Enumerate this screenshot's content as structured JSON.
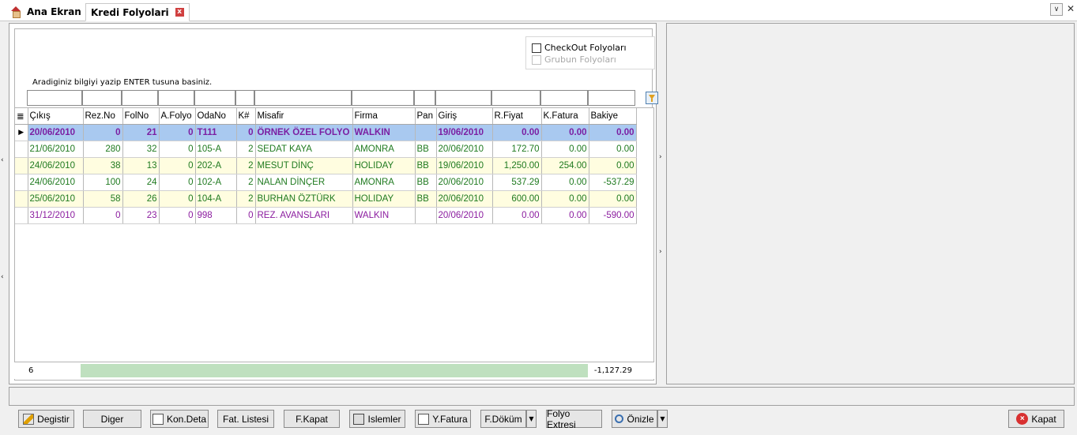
{
  "tabs": {
    "home": "Ana Ekran",
    "active": "Kredi Folyolari",
    "close_glyph": "x"
  },
  "window": {
    "dropdown_glyph": "∨",
    "close_glyph": "✕"
  },
  "filter": {
    "checkout_label": "CheckOut Folyoları",
    "grubun_label": "Grubun Folyoları",
    "hint": "Aradiginiz bilgiyi yazip ENTER tusuna basiniz."
  },
  "grid": {
    "columns": [
      "Çıkış",
      "Rez.No",
      "FolNo",
      "A.Folyo",
      "OdaNo",
      "K#",
      "Misafir",
      "Firma",
      "Pan",
      "Giriş",
      "R.Fiyat",
      "K.Fatura",
      "Bakiye"
    ],
    "rows": [
      [
        "20/06/2010",
        "0",
        "21",
        "0",
        "T111",
        "0",
        "ÖRNEK ÖZEL FOLYO",
        "WALKIN",
        "",
        "19/06/2010",
        "0.00",
        "0.00",
        "0.00"
      ],
      [
        "21/06/2010",
        "280",
        "32",
        "0",
        "105-A",
        "2",
        "SEDAT KAYA",
        "AMONRA",
        "BB",
        "20/06/2010",
        "172.70",
        "0.00",
        "0.00"
      ],
      [
        "24/06/2010",
        "38",
        "13",
        "0",
        "202-A",
        "2",
        "MESUT DİNÇ",
        "HOLIDAY",
        "BB",
        "19/06/2010",
        "1,250.00",
        "254.00",
        "0.00"
      ],
      [
        "24/06/2010",
        "100",
        "24",
        "0",
        "102-A",
        "2",
        "NALAN DİNÇER",
        "AMONRA",
        "BB",
        "20/06/2010",
        "537.29",
        "0.00",
        "-537.29"
      ],
      [
        "25/06/2010",
        "58",
        "26",
        "0",
        "104-A",
        "2",
        "BURHAN ÖZTÜRK",
        "HOLIDAY",
        "BB",
        "20/06/2010",
        "600.00",
        "0.00",
        "0.00"
      ],
      [
        "31/12/2010",
        "0",
        "23",
        "0",
        "998",
        "0",
        "REZ. AVANSLARI",
        "WALKIN",
        "",
        "20/06/2010",
        "0.00",
        "0.00",
        "-590.00"
      ]
    ],
    "footer_count": "6",
    "footer_total": "-1,127.29"
  },
  "buttons": {
    "degistir": "Degistir",
    "diger": "Diger",
    "kon_deta": "Kon.Deta",
    "fat_listesi": "Fat. Listesi",
    "f_kapat": "F.Kapat",
    "islemler": "Islemler",
    "y_fatura": "Y.Fatura",
    "f_dokum": "F.Döküm",
    "folyo_extresi": "Folyo Extresi",
    "onizle": "Önizle",
    "kapat": "Kapat"
  }
}
